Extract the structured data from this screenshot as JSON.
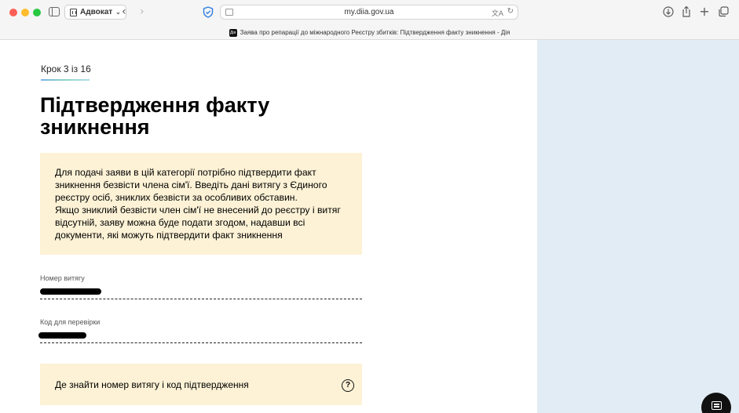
{
  "browser": {
    "profile_label": "Адвокат",
    "url": "my.diia.gov.ua",
    "tab_favicon": "Дія",
    "tab_title": "Заява про репарації до міжнародного Реєстру збитків: Підтвердження факту зникнення - Дія",
    "icons": {
      "back": "chevron-left-icon",
      "forward": "chevron-right-icon",
      "download": "download-icon",
      "share": "share-icon",
      "new_tab": "plus-icon",
      "tabs": "tabs-overview-icon"
    }
  },
  "page": {
    "step": "Крок 3 із 16",
    "title": "Підтвердження факту зникнення",
    "note_lines": [
      "Для подачі заяви в цій категорії потрібно підтвердити факт",
      "зникнення безвісти члена сім'ї. Введіть дані витягу з Єдиного",
      "реєстру осіб, зниклих безвісти за особливих обставин.",
      "Якщо зниклий безвісти член сім'ї не внесений до реєстру і витяг",
      "відсутній, заяву можна буде подати згодом, надавши всі",
      "документи, які можуть підтвердити факт зникнення"
    ],
    "fields": [
      {
        "label": "Номер витягу",
        "value_redacted": true
      },
      {
        "label": "Код для перевірки",
        "value_redacted": true
      }
    ],
    "help_link": "Де знайти номер витягу і код підтвердження",
    "help_icon": "question-circle-icon",
    "chat_icon": "chat-icon"
  },
  "colors": {
    "note_bg": "#fdf2d6",
    "right_panel_bg": "#e2ecf4",
    "step_bar_start": "#7ab4e8",
    "step_bar_end": "#b1dbe9"
  }
}
